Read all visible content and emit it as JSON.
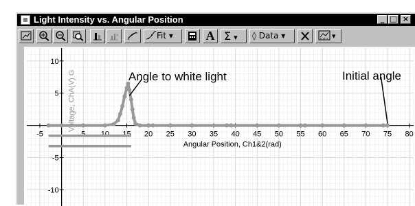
{
  "window": {
    "title": "Light Intensity vs. Angular Position"
  },
  "titlebar_buttons": {
    "minimize": "_",
    "maximize": "□",
    "close": "×"
  },
  "toolbar": {
    "fit_label": "Fit",
    "data_label": "Data",
    "text_label": "A",
    "stats_label": "Σ"
  },
  "annotations": {
    "white_light": "Angle to white light",
    "initial": "Initial angle"
  },
  "chart_data": {
    "type": "scatter",
    "xlabel": "Angular Position, Ch1&2(rad)",
    "ylabel": "Voltage, ChA(V) G",
    "xlim": [
      -8,
      81
    ],
    "ylim": [
      -12.5,
      12
    ],
    "x_ticks": [
      -5,
      5,
      10,
      15,
      20,
      25,
      30,
      35,
      40,
      45,
      50,
      55,
      60,
      65,
      70,
      75,
      80
    ],
    "y_ticks": [
      10,
      5,
      -5,
      -10
    ],
    "grid": true,
    "series": [
      {
        "points": [
          [
            -3,
            0
          ],
          [
            0,
            0
          ],
          [
            5,
            0
          ],
          [
            10,
            0
          ],
          [
            12,
            0.2
          ],
          [
            13,
            0.8
          ],
          [
            13.5,
            1.8
          ],
          [
            14,
            3.0
          ],
          [
            14.5,
            4.5
          ],
          [
            15,
            5.8
          ],
          [
            15.3,
            6.5
          ],
          [
            15.6,
            5.5
          ],
          [
            16,
            4.0
          ],
          [
            16.3,
            2.5
          ],
          [
            16.6,
            1.2
          ],
          [
            17,
            0.3
          ],
          [
            18,
            0
          ],
          [
            20,
            0
          ],
          [
            21,
            0
          ],
          [
            25,
            0
          ],
          [
            30,
            0
          ],
          [
            38,
            0
          ],
          [
            39,
            0
          ],
          [
            45,
            0
          ],
          [
            50,
            0
          ],
          [
            55,
            0
          ],
          [
            56,
            0
          ],
          [
            60,
            0
          ],
          [
            65,
            0
          ],
          [
            70,
            0
          ],
          [
            74,
            0
          ],
          [
            75,
            0
          ]
        ]
      }
    ]
  },
  "colors": {
    "data_gray": "#999999",
    "grid_gray": "#d9d9d9",
    "titlebar": "#000000",
    "window_face": "#c0c0c0"
  }
}
